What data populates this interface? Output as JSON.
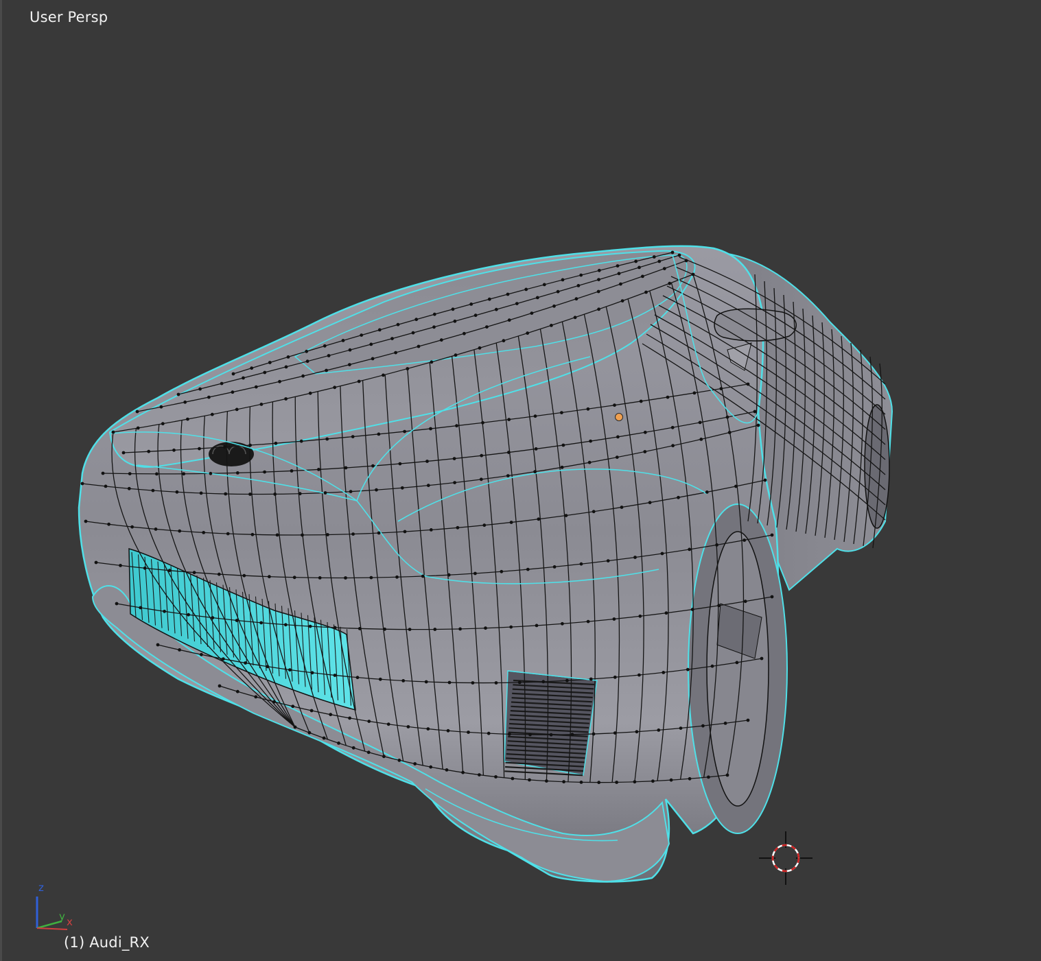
{
  "viewport": {
    "view_label": "User Persp",
    "object_label": "(1) Audi_RX",
    "object_name": "Audi_RX",
    "background_color": "#393939"
  },
  "model": {
    "description_icon": "mesh-car-model",
    "face_color": "#8e8e96",
    "wire_color": "#111111",
    "seam_color": "#4fe0e8",
    "selected_vertex_color": "#f0a050"
  },
  "axis_gizmo": {
    "x_label": "x",
    "y_label": "y",
    "z_label": "z",
    "x_color": "#d04040",
    "y_color": "#40b040",
    "z_color": "#3060d8"
  },
  "cursor_3d": {
    "icon": "3d-cursor-icon",
    "ring_colors": [
      "#d02020",
      "#ffffff"
    ]
  }
}
